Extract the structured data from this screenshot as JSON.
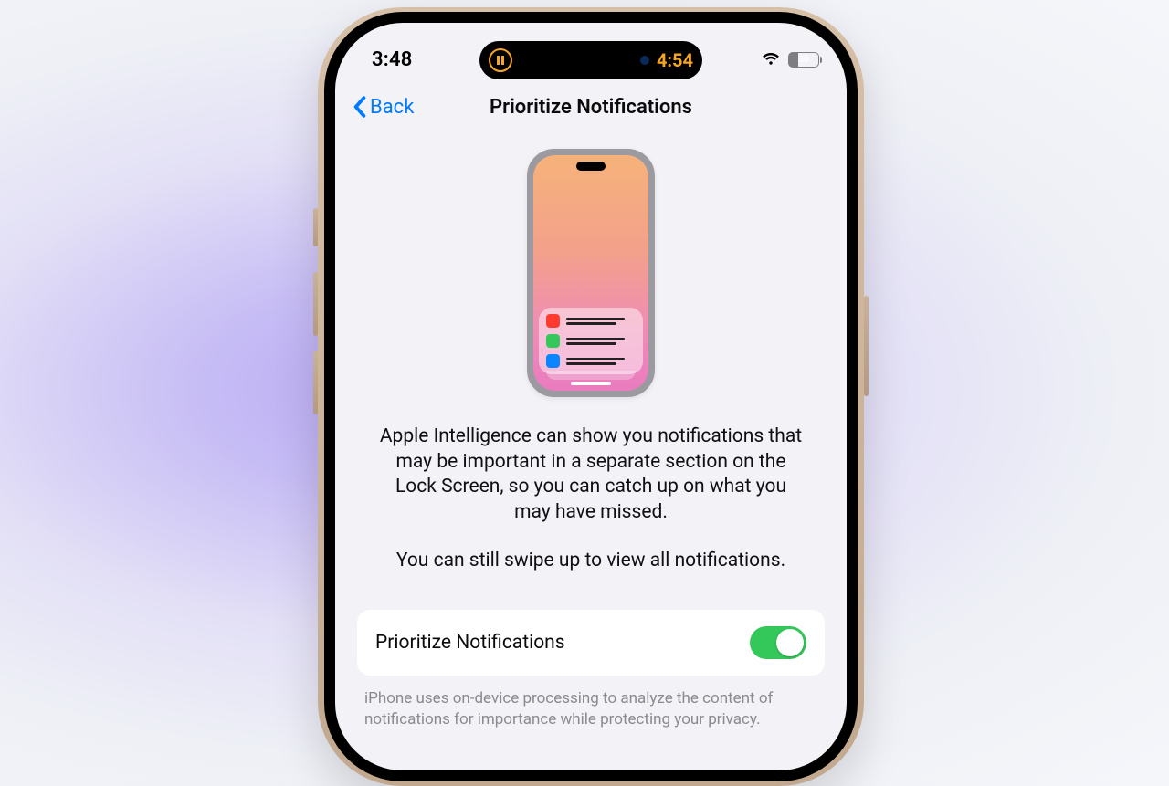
{
  "status": {
    "time_left": "3:48",
    "island_time": "4:54",
    "battery_pct": "30"
  },
  "nav": {
    "back_label": "Back",
    "title": "Prioritize Notifications"
  },
  "description": {
    "p1": "Apple Intelligence can show you notifications that may be important in a separate section on the Lock Screen, so you can catch up on what you may have missed.",
    "p2": "You can still swipe up to view all notifications."
  },
  "toggle": {
    "label": "Prioritize Notifications",
    "on": true
  },
  "footer": "iPhone uses on-device processing to analyze the content of notifications for importance while protecting your privacy.",
  "illustration": {
    "rows": [
      {
        "color": "red"
      },
      {
        "color": "green"
      },
      {
        "color": "blue"
      }
    ]
  }
}
